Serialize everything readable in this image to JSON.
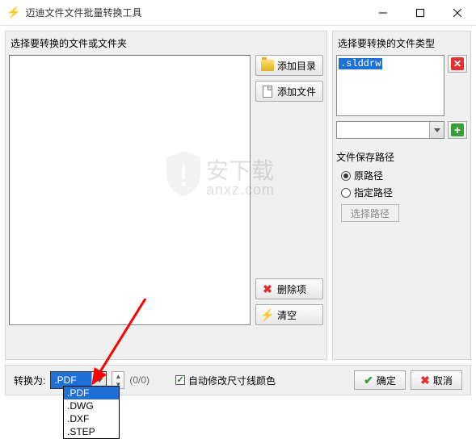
{
  "titlebar": {
    "title": "迈迪文件文件批量转换工具"
  },
  "left": {
    "label": "选择要转换的文件或文件夹",
    "add_dir": "添加目录",
    "add_file": "添加文件",
    "delete_item": "删除项",
    "clear": "清空"
  },
  "right": {
    "type_label": "选择要转换的文件类型",
    "type_item": ".slddrw",
    "save_path_label": "文件保存路径",
    "original_path": "原路径",
    "custom_path": "指定路径",
    "select_path": "选择路径"
  },
  "bottom": {
    "convert_label": "转换为:",
    "selected_format": ".PDF",
    "count": "(0/0)",
    "auto_modify": "自动修改尺寸线颜色",
    "ok": "确定",
    "cancel": "取消"
  },
  "dropdown": {
    "items": [
      ".PDF",
      ".DWG",
      ".DXF",
      ".STEP"
    ],
    "selected_index": 0
  },
  "watermark": {
    "text": "安下载",
    "url": "anxz.com"
  }
}
